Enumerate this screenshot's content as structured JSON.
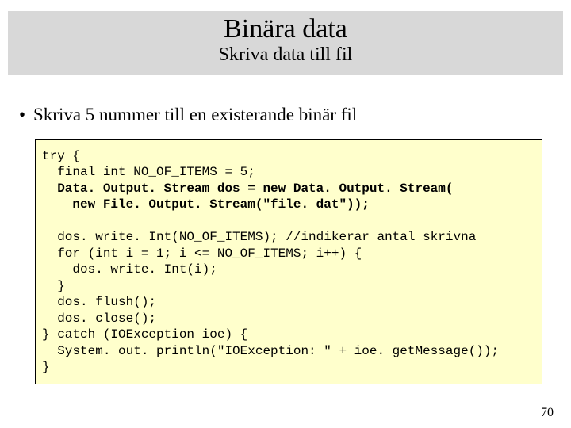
{
  "header": {
    "title": "Binära data",
    "subtitle": "Skriva data till fil"
  },
  "bullet": "Skriva 5 nummer till en existerande binär fil",
  "code": {
    "l1": "try {",
    "l2": "  final int NO_OF_ITEMS = 5;",
    "l3a": "  ",
    "l3b": "Data. Output. Stream dos = new Data. Output. Stream(",
    "l4": "    new File. Output. Stream(\"file. dat\"));",
    "blank": "",
    "l6": "  dos. write. Int(NO_OF_ITEMS); //indikerar antal skrivna",
    "l7": "  for (int i = 1; i <= NO_OF_ITEMS; i++) {",
    "l8": "    dos. write. Int(i);",
    "l9": "  }",
    "l10": "  dos. flush();",
    "l11": "  dos. close();",
    "l12": "} catch (IOException ioe) {",
    "l13": "  System. out. println(\"IOException: \" + ioe. getMessage());",
    "l14": "}"
  },
  "pageNumber": "70"
}
